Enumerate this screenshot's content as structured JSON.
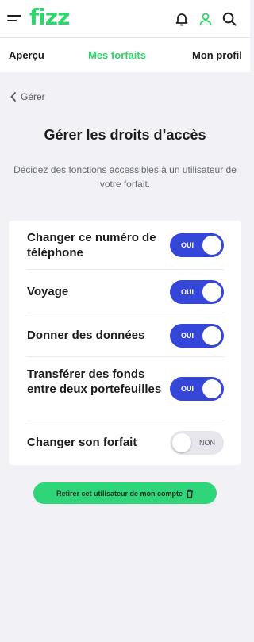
{
  "header": {
    "logo": "fizz",
    "icons": [
      "menu-icon",
      "bell-icon",
      "user-icon",
      "search-icon"
    ],
    "brand_color": "#2fd66b"
  },
  "tabs": [
    {
      "label": "Aperçu",
      "active": false
    },
    {
      "label": "Mes forfaits",
      "active": true
    },
    {
      "label": "Mon profil",
      "active": false
    }
  ],
  "back": {
    "label": "Gérer"
  },
  "page": {
    "title": "Gérer les droits d’accès",
    "description": "Décidez des fonctions accessibles à un utilisateur de votre forfait."
  },
  "permissions": [
    {
      "label": "Changer ce numéro de téléphone",
      "state": "OUI",
      "enabled": true
    },
    {
      "label": "Voyage",
      "state": "OUI",
      "enabled": true
    },
    {
      "label": "Donner des données",
      "state": "OUI",
      "enabled": true
    },
    {
      "label": "Transférer des fonds entre deux portefeuilles",
      "state": "OUI",
      "enabled": true
    },
    {
      "label": "Changer son forfait",
      "state": "NON",
      "enabled": false
    }
  ],
  "actions": {
    "remove_user": "Retirer cet utilisateur de mon compte"
  },
  "colors": {
    "toggle_on": "#3547d9",
    "toggle_off": "#e6e6ec",
    "button": "#2fd679"
  }
}
